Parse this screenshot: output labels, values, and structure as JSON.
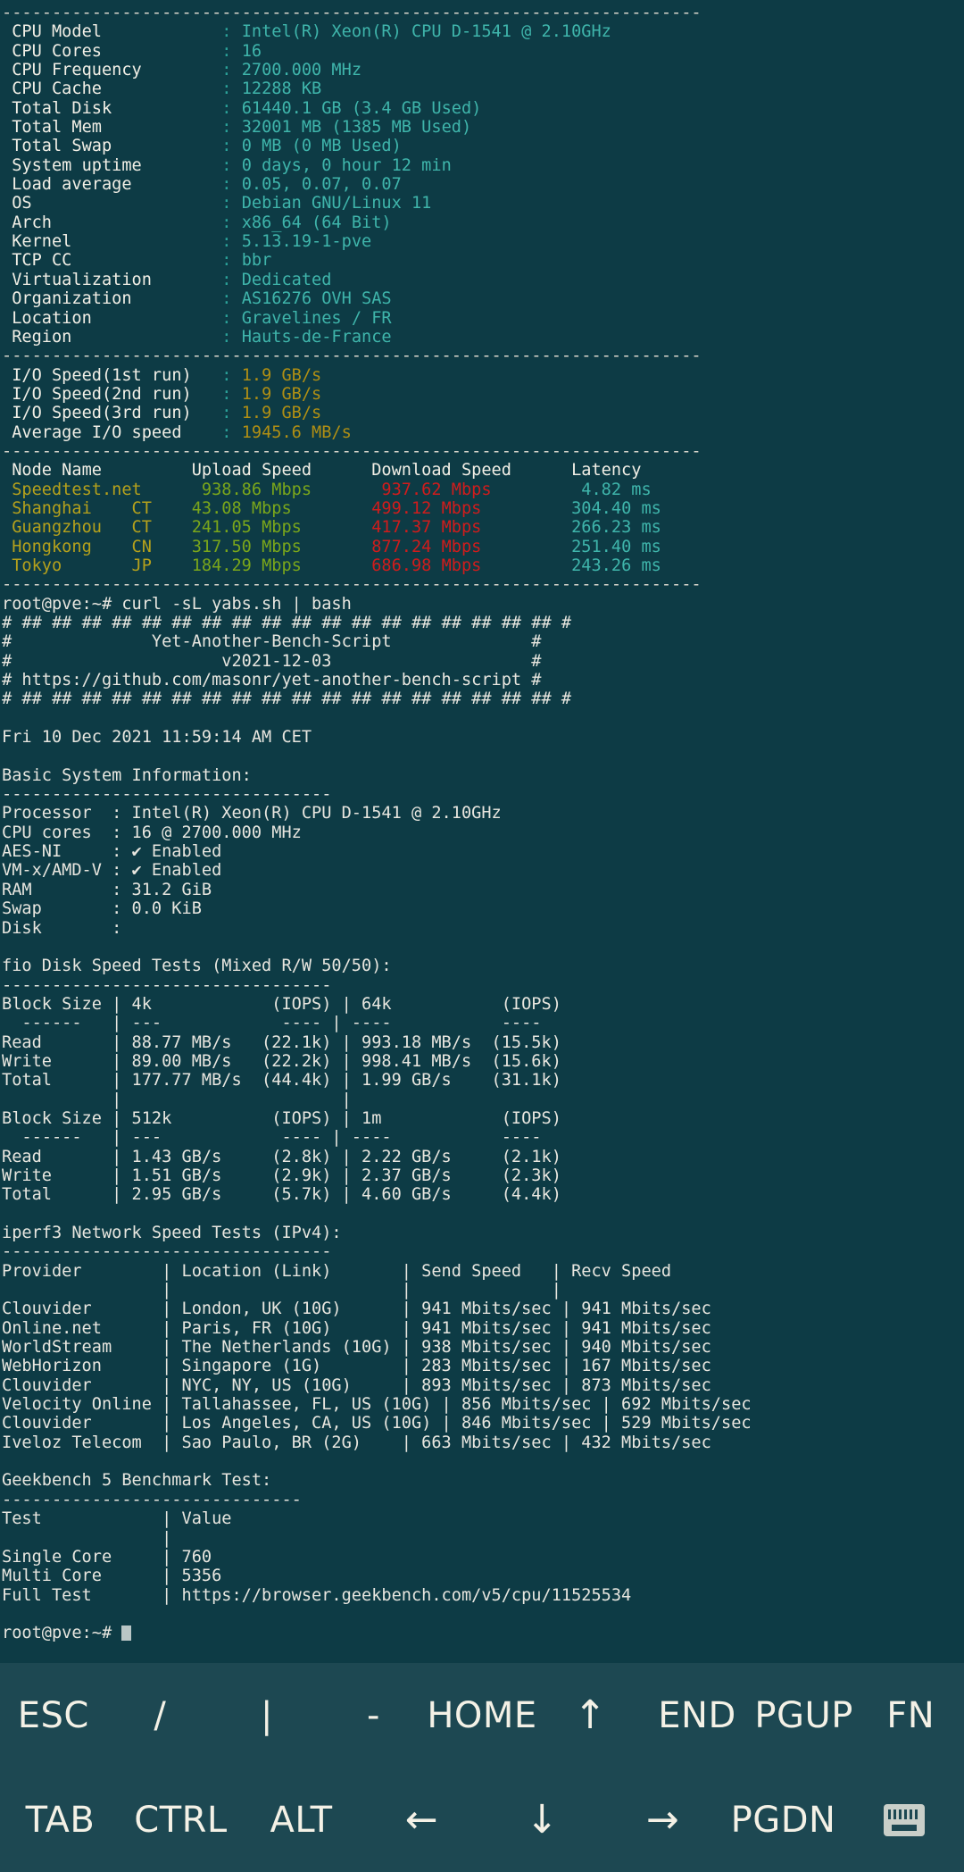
{
  "theme": {
    "background": "#0d3b45",
    "foreground": "#e8e6df",
    "keybar_background": "#1d4852",
    "cyan": "#2aa198",
    "yellow": "#b5a11c",
    "green": "#7aa61b",
    "red": "#d01c1c",
    "white": "#f2efe6"
  },
  "terminal": {
    "separator_top": "----------------------------------------------------------------------",
    "sysinfo_labels": [
      "CPU Model",
      "CPU Cores",
      "CPU Frequency",
      "CPU Cache",
      "Total Disk",
      "Total Mem",
      "Total Swap",
      "System uptime",
      "Load average",
      "OS",
      "Arch",
      "Kernel",
      "TCP CC",
      "Virtualization",
      "Organization",
      "Location",
      "Region"
    ],
    "sysinfo_values": [
      "Intel(R) Xeon(R) CPU D-1541 @ 2.10GHz",
      "16",
      "2700.000 MHz",
      "12288 KB",
      "61440.1 GB (3.4 GB Used)",
      "32001 MB (1385 MB Used)",
      "0 MB (0 MB Used)",
      "0 days, 0 hour 12 min",
      "0.05, 0.07, 0.07",
      "Debian GNU/Linux 11",
      "x86_64 (64 Bit)",
      "5.13.19-1-pve",
      "bbr",
      "Dedicated",
      "AS16276 OVH SAS",
      "Gravelines / FR",
      "Hauts-de-France"
    ],
    "io_labels": [
      "I/O Speed(1st run)",
      "I/O Speed(2nd run)",
      "I/O Speed(3rd run)",
      "Average I/O speed"
    ],
    "io_values": [
      "1.9 GB/s",
      "1.9 GB/s",
      "1.9 GB/s",
      "1945.6 MB/s"
    ],
    "speedtest_header": {
      "node": "Node Name",
      "upload": "Upload Speed",
      "download": "Download Speed",
      "latency": "Latency"
    },
    "speedtest_rows": [
      {
        "node": "Speedtest.net",
        "isp": "",
        "upload": "938.86 Mbps",
        "download": "937.62 Mbps",
        "latency": "4.82 ms"
      },
      {
        "node": "Shanghai",
        "isp": "CT",
        "upload": "43.08 Mbps",
        "download": "499.12 Mbps",
        "latency": "304.40 ms"
      },
      {
        "node": "Guangzhou",
        "isp": "CT",
        "upload": "241.05 Mbps",
        "download": "417.37 Mbps",
        "latency": "266.23 ms"
      },
      {
        "node": "Hongkong",
        "isp": "CN",
        "upload": "317.50 Mbps",
        "download": "877.24 Mbps",
        "latency": "251.40 ms"
      },
      {
        "node": "Tokyo",
        "isp": "JP",
        "upload": "184.29 Mbps",
        "download": "686.98 Mbps",
        "latency": "243.26 ms"
      }
    ],
    "prompt_1": "root@pve:~# ",
    "command_1": "curl -sL yabs.sh | bash",
    "banner": [
      "# ## ## ## ## ## ## ## ## ## ## ## ## ## ## ## ## ## ## #",
      "#              Yet-Another-Bench-Script              #",
      "#                     v2021-12-03                    #",
      "# https://github.com/masonr/yet-another-bench-script #",
      "# ## ## ## ## ## ## ## ## ## ## ## ## ## ## ## ## ## ## #"
    ],
    "date_line": "Fri 10 Dec 2021 11:59:14 AM CET",
    "basic_info_title": "Basic System Information:",
    "basic_info_rule": "---------------------------------",
    "basic_info_labels": [
      "Processor",
      "CPU cores",
      "AES-NI",
      "VM-x/AMD-V",
      "RAM",
      "Swap",
      "Disk"
    ],
    "basic_info_values": [
      "Intel(R) Xeon(R) CPU D-1541 @ 2.10GHz",
      "16 @ 2700.000 MHz",
      "✔ Enabled",
      "✔ Enabled",
      "31.2 GiB",
      "0.0 KiB",
      ""
    ],
    "fio_title": "fio Disk Speed Tests (Mixed R/W 50/50):",
    "fio_rule": "---------------------------------",
    "fio_block1": {
      "header": "Block Size | 4k            (IOPS) | 64k           (IOPS)",
      "rule": "  ------   | ---            ---- | ----           ----",
      "rows": [
        "Read       | 88.77 MB/s   (22.1k) | 993.18 MB/s  (15.5k)",
        "Write      | 89.00 MB/s   (22.2k) | 998.41 MB/s  (15.6k)",
        "Total      | 177.77 MB/s  (44.4k) | 1.99 GB/s    (31.1k)",
        "           |                      |"
      ]
    },
    "fio_block2": {
      "header": "Block Size | 512k          (IOPS) | 1m            (IOPS)",
      "rule": "  ------   | ---            ---- | ----           ----",
      "rows": [
        "Read       | 1.43 GB/s     (2.8k) | 2.22 GB/s     (2.1k)",
        "Write      | 1.51 GB/s     (2.9k) | 2.37 GB/s     (2.3k)",
        "Total      | 2.95 GB/s     (5.7k) | 4.60 GB/s     (4.4k)"
      ]
    },
    "iperf_title": "iperf3 Network Speed Tests (IPv4):",
    "iperf_rule": "---------------------------------",
    "iperf_header": "Provider        | Location (Link)       | Send Speed   | Recv Speed",
    "iperf_blank": "                |                       |              |",
    "iperf_rows": [
      "Clouvider       | London, UK (10G)      | 941 Mbits/sec | 941 Mbits/sec",
      "Online.net      | Paris, FR (10G)       | 941 Mbits/sec | 941 Mbits/sec",
      "WorldStream     | The Netherlands (10G) | 938 Mbits/sec | 940 Mbits/sec",
      "WebHorizon      | Singapore (1G)        | 283 Mbits/sec | 167 Mbits/sec",
      "Clouvider       | NYC, NY, US (10G)     | 893 Mbits/sec | 873 Mbits/sec",
      "Velocity Online | Tallahassee, FL, US (10G) | 856 Mbits/sec | 692 Mbits/sec",
      "Clouvider       | Los Angeles, CA, US (10G) | 846 Mbits/sec | 529 Mbits/sec",
      "Iveloz Telecom  | Sao Paulo, BR (2G)    | 663 Mbits/sec | 432 Mbits/sec"
    ],
    "geekbench_title": "Geekbench 5 Benchmark Test:",
    "geekbench_rule": "------------------------------",
    "geekbench_header": "Test            | Value",
    "geekbench_blank": "                |",
    "geekbench_rows": [
      "Single Core     | 760",
      "Multi Core      | 5356",
      "Full Test       | https://browser.geekbench.com/v5/cpu/11525534"
    ],
    "prompt_2": "root@pve:~# "
  },
  "keyboard": {
    "row1": [
      {
        "label": "ESC",
        "name": "key-esc"
      },
      {
        "label": "/",
        "name": "key-slash"
      },
      {
        "label": "|",
        "name": "key-pipe"
      },
      {
        "label": "-",
        "name": "key-dash"
      },
      {
        "label": "HOME",
        "name": "key-home"
      },
      {
        "label": "↑",
        "name": "key-arrow-up",
        "arrow": true
      },
      {
        "label": "END",
        "name": "key-end"
      },
      {
        "label": "PGUP",
        "name": "key-pgup"
      },
      {
        "label": "FN",
        "name": "key-fn"
      }
    ],
    "row2": [
      {
        "label": "TAB",
        "name": "key-tab"
      },
      {
        "label": "CTRL",
        "name": "key-ctrl"
      },
      {
        "label": "ALT",
        "name": "key-alt"
      },
      {
        "label": "←",
        "name": "key-arrow-left",
        "arrow": true
      },
      {
        "label": "↓",
        "name": "key-arrow-down",
        "arrow": true
      },
      {
        "label": "→",
        "name": "key-arrow-right",
        "arrow": true
      },
      {
        "label": "PGDN",
        "name": "key-pgdn"
      },
      {
        "label": "",
        "name": "keyboard-toggle-icon",
        "icon": "keyboard"
      }
    ]
  }
}
